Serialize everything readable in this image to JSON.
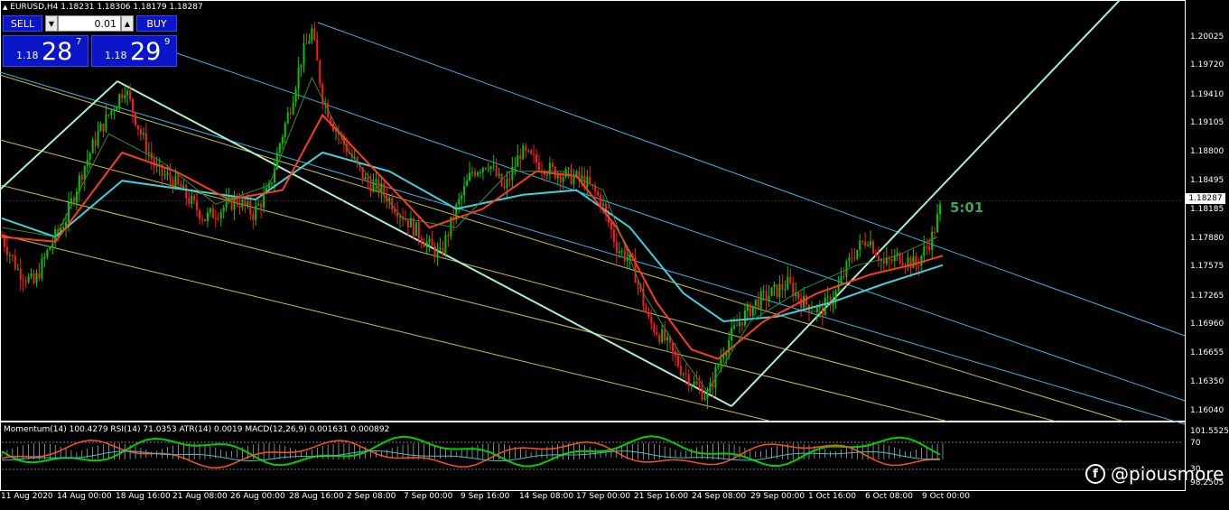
{
  "symbol_header": "EURUSD,H4  1.18231 1.18306 1.18179 1.18287",
  "trade_panel": {
    "sell_label": "SELL",
    "buy_label": "BUY",
    "lot_value": "0.01",
    "sell_price_small": "1.18",
    "sell_price_big": "28",
    "sell_price_sup": "7",
    "buy_price_small": "1.18",
    "buy_price_big": "29",
    "buy_price_sup": "9",
    "stepper_down_icon": "triangle-down",
    "stepper_up_icon": "triangle-up"
  },
  "countdown": "5:01",
  "current_price": "1.18287",
  "indicator_header": "Momentum(14) 100.4279  RSI(14) 71.0353  ATR(14) 0.0019  MACD(12,26,9) 0.001631 0.000892",
  "watermark": "@piousmore",
  "colors": {
    "background": "#000000",
    "bull_candle": "#00c800",
    "bear_candle": "#ff1a1a",
    "ma_fast": "#2f8f2f",
    "ma_mid": "#ff3b1f",
    "ma_slow": "#3fd0d8",
    "trendline": "#a8f0d0",
    "channel_blue": "#3fb0e0",
    "channel_yellow": "#c8c040",
    "panel_blue": "#0b16c9"
  },
  "chart_data": {
    "type": "candlestick",
    "symbol": "EURUSD",
    "timeframe": "H4",
    "ohlc_last": {
      "open": 1.18231,
      "high": 1.18306,
      "low": 1.18179,
      "close": 1.18287
    },
    "price_ticks": [
      "1.20025",
      "1.19720",
      "1.19410",
      "1.19105",
      "1.18800",
      "1.18495",
      "1.18185",
      "1.17880",
      "1.17575",
      "1.17265",
      "1.16960",
      "1.16655",
      "1.16350",
      "1.16040"
    ],
    "time_ticks": [
      "11 Aug 2020",
      "14 Aug 00:00",
      "18 Aug 16:00",
      "21 Aug 08:00",
      "26 Aug 00:00",
      "28 Aug 16:00",
      "2 Sep 08:00",
      "7 Sep 00:00",
      "9 Sep 16:00",
      "14 Sep 08:00",
      "17 Sep 00:00",
      "21 Sep 16:00",
      "24 Sep 08:00",
      "29 Sep 00:00",
      "1 Oct 16:00",
      "6 Oct 08:00",
      "9 Oct 00:00"
    ],
    "ylim": [
      1.1598,
      1.2035
    ],
    "close_path": [
      [
        0,
        1.179
      ],
      [
        6,
        1.1755
      ],
      [
        12,
        1.174
      ],
      [
        18,
        1.178
      ],
      [
        24,
        1.181
      ],
      [
        30,
        1.186
      ],
      [
        36,
        1.19
      ],
      [
        42,
        1.193
      ],
      [
        46,
        1.195
      ],
      [
        52,
        1.19
      ],
      [
        58,
        1.186
      ],
      [
        64,
        1.185
      ],
      [
        70,
        1.183
      ],
      [
        76,
        1.181
      ],
      [
        82,
        1.182
      ],
      [
        88,
        1.183
      ],
      [
        94,
        1.1815
      ],
      [
        100,
        1.184
      ],
      [
        104,
        1.189
      ],
      [
        108,
        1.193
      ],
      [
        112,
        1.198
      ],
      [
        116,
        1.201
      ],
      [
        120,
        1.194
      ],
      [
        124,
        1.191
      ],
      [
        130,
        1.188
      ],
      [
        136,
        1.185
      ],
      [
        142,
        1.184
      ],
      [
        148,
        1.182
      ],
      [
        154,
        1.18
      ],
      [
        160,
        1.178
      ],
      [
        164,
        1.177
      ],
      [
        170,
        1.182
      ],
      [
        176,
        1.186
      ],
      [
        182,
        1.187
      ],
      [
        188,
        1.184
      ],
      [
        194,
        1.188
      ],
      [
        200,
        1.187
      ],
      [
        206,
        1.186
      ],
      [
        212,
        1.1855
      ],
      [
        218,
        1.185
      ],
      [
        224,
        1.183
      ],
      [
        230,
        1.178
      ],
      [
        236,
        1.176
      ],
      [
        242,
        1.17
      ],
      [
        248,
        1.168
      ],
      [
        254,
        1.165
      ],
      [
        260,
        1.163
      ],
      [
        264,
        1.162
      ],
      [
        270,
        1.167
      ],
      [
        276,
        1.17
      ],
      [
        282,
        1.172
      ],
      [
        288,
        1.173
      ],
      [
        294,
        1.174
      ],
      [
        300,
        1.172
      ],
      [
        306,
        1.171
      ],
      [
        312,
        1.173
      ],
      [
        318,
        1.177
      ],
      [
        324,
        1.179
      ],
      [
        330,
        1.176
      ],
      [
        336,
        1.177
      ],
      [
        342,
        1.176
      ],
      [
        348,
        1.179
      ],
      [
        352,
        1.1829
      ]
    ],
    "ma_fast": [
      [
        0,
        1.18
      ],
      [
        20,
        1.179
      ],
      [
        40,
        1.19
      ],
      [
        60,
        1.187
      ],
      [
        80,
        1.1825
      ],
      [
        100,
        1.1845
      ],
      [
        116,
        1.196
      ],
      [
        130,
        1.188
      ],
      [
        150,
        1.181
      ],
      [
        170,
        1.18
      ],
      [
        190,
        1.186
      ],
      [
        210,
        1.186
      ],
      [
        225,
        1.184
      ],
      [
        240,
        1.173
      ],
      [
        255,
        1.166
      ],
      [
        264,
        1.1625
      ],
      [
        280,
        1.17
      ],
      [
        300,
        1.1735
      ],
      [
        320,
        1.176
      ],
      [
        335,
        1.177
      ],
      [
        350,
        1.179
      ]
    ],
    "ma_mid": [
      [
        0,
        1.179
      ],
      [
        20,
        1.1785
      ],
      [
        45,
        1.188
      ],
      [
        65,
        1.186
      ],
      [
        85,
        1.183
      ],
      [
        105,
        1.184
      ],
      [
        120,
        1.192
      ],
      [
        140,
        1.186
      ],
      [
        160,
        1.18
      ],
      [
        180,
        1.182
      ],
      [
        200,
        1.186
      ],
      [
        215,
        1.1855
      ],
      [
        230,
        1.18
      ],
      [
        245,
        1.172
      ],
      [
        258,
        1.167
      ],
      [
        268,
        1.166
      ],
      [
        285,
        1.17
      ],
      [
        305,
        1.173
      ],
      [
        325,
        1.175
      ],
      [
        340,
        1.176
      ],
      [
        352,
        1.177
      ]
    ],
    "ma_slow": [
      [
        0,
        1.181
      ],
      [
        20,
        1.179
      ],
      [
        45,
        1.185
      ],
      [
        70,
        1.184
      ],
      [
        95,
        1.183
      ],
      [
        120,
        1.188
      ],
      [
        145,
        1.186
      ],
      [
        170,
        1.182
      ],
      [
        195,
        1.1835
      ],
      [
        215,
        1.184
      ],
      [
        235,
        1.18
      ],
      [
        255,
        1.173
      ],
      [
        270,
        1.17
      ],
      [
        290,
        1.1705
      ],
      [
        310,
        1.172
      ],
      [
        330,
        1.174
      ],
      [
        352,
        1.176
      ]
    ],
    "indicators": {
      "momentum_period": 14,
      "momentum_value": 100.4279,
      "rsi_period": 14,
      "rsi_value": 71.0353,
      "atr_period": 14,
      "atr_value": 0.0019,
      "macd_params": "12,26,9",
      "macd_main": 0.001631,
      "macd_signal": 0.000892
    },
    "subwindow_ticks": [
      "101.5525",
      "70",
      "30",
      "98.2505"
    ],
    "subwindow_levels": [
      70,
      30
    ],
    "grid": false
  }
}
